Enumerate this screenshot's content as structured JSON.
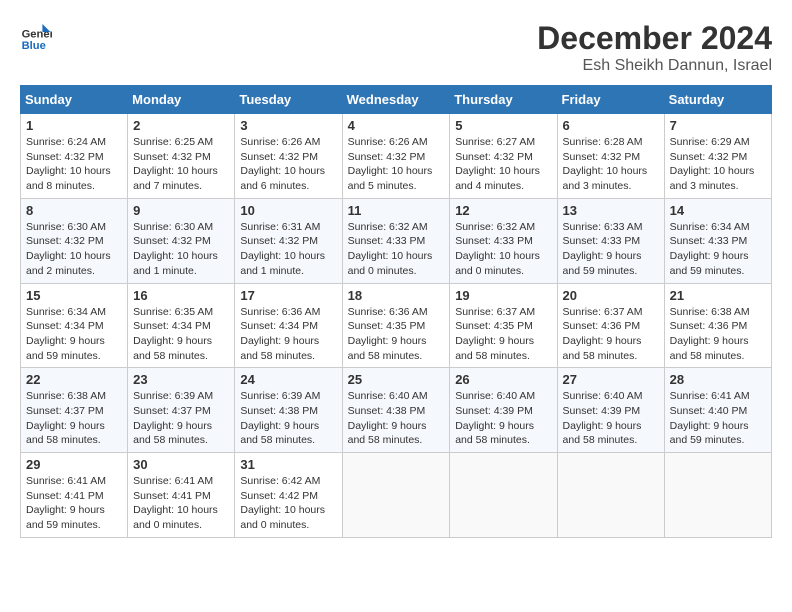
{
  "header": {
    "logo_general": "General",
    "logo_blue": "Blue",
    "month_title": "December 2024",
    "location": "Esh Sheikh Dannun, Israel"
  },
  "days_of_week": [
    "Sunday",
    "Monday",
    "Tuesday",
    "Wednesday",
    "Thursday",
    "Friday",
    "Saturday"
  ],
  "weeks": [
    [
      {
        "day": "1",
        "sunrise": "6:24 AM",
        "sunset": "4:32 PM",
        "daylight": "10 hours and 8 minutes."
      },
      {
        "day": "2",
        "sunrise": "6:25 AM",
        "sunset": "4:32 PM",
        "daylight": "10 hours and 7 minutes."
      },
      {
        "day": "3",
        "sunrise": "6:26 AM",
        "sunset": "4:32 PM",
        "daylight": "10 hours and 6 minutes."
      },
      {
        "day": "4",
        "sunrise": "6:26 AM",
        "sunset": "4:32 PM",
        "daylight": "10 hours and 5 minutes."
      },
      {
        "day": "5",
        "sunrise": "6:27 AM",
        "sunset": "4:32 PM",
        "daylight": "10 hours and 4 minutes."
      },
      {
        "day": "6",
        "sunrise": "6:28 AM",
        "sunset": "4:32 PM",
        "daylight": "10 hours and 3 minutes."
      },
      {
        "day": "7",
        "sunrise": "6:29 AM",
        "sunset": "4:32 PM",
        "daylight": "10 hours and 3 minutes."
      }
    ],
    [
      {
        "day": "8",
        "sunrise": "6:30 AM",
        "sunset": "4:32 PM",
        "daylight": "10 hours and 2 minutes."
      },
      {
        "day": "9",
        "sunrise": "6:30 AM",
        "sunset": "4:32 PM",
        "daylight": "10 hours and 1 minute."
      },
      {
        "day": "10",
        "sunrise": "6:31 AM",
        "sunset": "4:32 PM",
        "daylight": "10 hours and 1 minute."
      },
      {
        "day": "11",
        "sunrise": "6:32 AM",
        "sunset": "4:33 PM",
        "daylight": "10 hours and 0 minutes."
      },
      {
        "day": "12",
        "sunrise": "6:32 AM",
        "sunset": "4:33 PM",
        "daylight": "10 hours and 0 minutes."
      },
      {
        "day": "13",
        "sunrise": "6:33 AM",
        "sunset": "4:33 PM",
        "daylight": "9 hours and 59 minutes."
      },
      {
        "day": "14",
        "sunrise": "6:34 AM",
        "sunset": "4:33 PM",
        "daylight": "9 hours and 59 minutes."
      }
    ],
    [
      {
        "day": "15",
        "sunrise": "6:34 AM",
        "sunset": "4:34 PM",
        "daylight": "9 hours and 59 minutes."
      },
      {
        "day": "16",
        "sunrise": "6:35 AM",
        "sunset": "4:34 PM",
        "daylight": "9 hours and 58 minutes."
      },
      {
        "day": "17",
        "sunrise": "6:36 AM",
        "sunset": "4:34 PM",
        "daylight": "9 hours and 58 minutes."
      },
      {
        "day": "18",
        "sunrise": "6:36 AM",
        "sunset": "4:35 PM",
        "daylight": "9 hours and 58 minutes."
      },
      {
        "day": "19",
        "sunrise": "6:37 AM",
        "sunset": "4:35 PM",
        "daylight": "9 hours and 58 minutes."
      },
      {
        "day": "20",
        "sunrise": "6:37 AM",
        "sunset": "4:36 PM",
        "daylight": "9 hours and 58 minutes."
      },
      {
        "day": "21",
        "sunrise": "6:38 AM",
        "sunset": "4:36 PM",
        "daylight": "9 hours and 58 minutes."
      }
    ],
    [
      {
        "day": "22",
        "sunrise": "6:38 AM",
        "sunset": "4:37 PM",
        "daylight": "9 hours and 58 minutes."
      },
      {
        "day": "23",
        "sunrise": "6:39 AM",
        "sunset": "4:37 PM",
        "daylight": "9 hours and 58 minutes."
      },
      {
        "day": "24",
        "sunrise": "6:39 AM",
        "sunset": "4:38 PM",
        "daylight": "9 hours and 58 minutes."
      },
      {
        "day": "25",
        "sunrise": "6:40 AM",
        "sunset": "4:38 PM",
        "daylight": "9 hours and 58 minutes."
      },
      {
        "day": "26",
        "sunrise": "6:40 AM",
        "sunset": "4:39 PM",
        "daylight": "9 hours and 58 minutes."
      },
      {
        "day": "27",
        "sunrise": "6:40 AM",
        "sunset": "4:39 PM",
        "daylight": "9 hours and 58 minutes."
      },
      {
        "day": "28",
        "sunrise": "6:41 AM",
        "sunset": "4:40 PM",
        "daylight": "9 hours and 59 minutes."
      }
    ],
    [
      {
        "day": "29",
        "sunrise": "6:41 AM",
        "sunset": "4:41 PM",
        "daylight": "9 hours and 59 minutes."
      },
      {
        "day": "30",
        "sunrise": "6:41 AM",
        "sunset": "4:41 PM",
        "daylight": "10 hours and 0 minutes."
      },
      {
        "day": "31",
        "sunrise": "6:42 AM",
        "sunset": "4:42 PM",
        "daylight": "10 hours and 0 minutes."
      },
      null,
      null,
      null,
      null
    ]
  ]
}
